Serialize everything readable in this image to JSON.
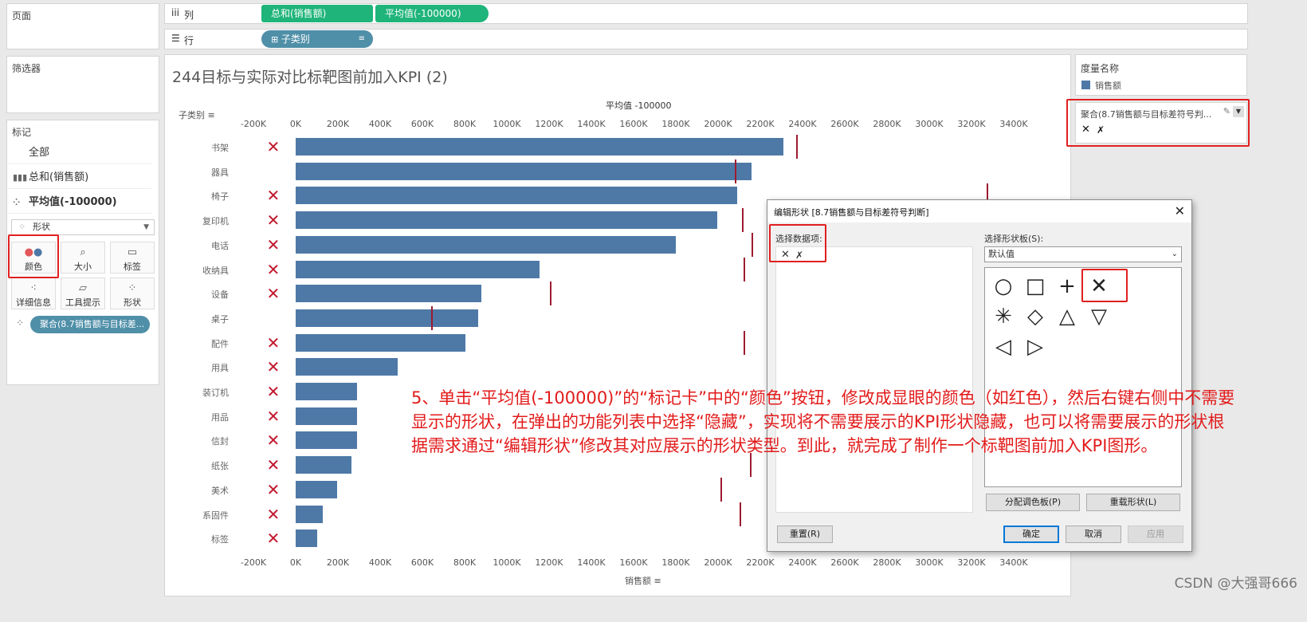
{
  "left_panel": {
    "pages_title": "页面",
    "filters_title": "筛选器",
    "marks_title": "标记",
    "marks_rows": [
      {
        "label": "全部",
        "icon": "none"
      },
      {
        "label": "总和(销售额)",
        "icon": "bar-chart-icon"
      },
      {
        "label": "平均值(-100000)",
        "icon": "shapes-icon"
      }
    ],
    "mark_type": "形状",
    "buttons": {
      "color": "颜色",
      "size": "大小",
      "label": "标签",
      "detail": "详细信息",
      "tooltip": "工具提示",
      "shape": "形状"
    },
    "shape_pill": "聚合(8.7销售额与目标差..."
  },
  "shelves": {
    "columns_icon": "iii",
    "columns_label": "列",
    "columns_pills": [
      "总和(销售额)",
      "平均值(-100000)"
    ],
    "rows_icon": "☰",
    "rows_label": "行",
    "rows_pill": "子类别"
  },
  "view": {
    "title": "244目标与实际对比标靶图前加入KPI (2)",
    "rows_header": "子类别",
    "top_axis_title": "平均值 -100000",
    "bottom_axis_title": "销售额"
  },
  "legend": {
    "title": "度量名称",
    "item": "销售额",
    "item_color": "#4e79a7",
    "shape_card_title": "聚合(8.7销售额与目标差符号判...",
    "shape_items": [
      "✕",
      "✗"
    ]
  },
  "chart_data": {
    "type": "bar",
    "xlim": [
      -200000,
      3500000
    ],
    "x_ticks": [
      "-200K",
      "0K",
      "200K",
      "400K",
      "600K",
      "800K",
      "1000K",
      "1200K",
      "1400K",
      "1600K",
      "1800K",
      "2000K",
      "2200K",
      "2400K",
      "2600K",
      "2800K",
      "3000K",
      "3200K",
      "3400K"
    ],
    "categories": [
      "书架",
      "器具",
      "椅子",
      "复印机",
      "电话",
      "收纳具",
      "设备",
      "桌子",
      "配件",
      "用具",
      "装订机",
      "用品",
      "信封",
      "纸张",
      "美术",
      "系固件",
      "标签"
    ],
    "series": [
      {
        "name": "销售额",
        "values": [
          2310000,
          2160000,
          2090000,
          1995000,
          1800000,
          1155000,
          878000,
          865000,
          805000,
          482000,
          292000,
          290000,
          290000,
          265000,
          198000,
          130000,
          100000
        ]
      }
    ],
    "targets": [
      2370000,
      2080000,
      3270000,
      2115000,
      2160000,
      2120000,
      1205000,
      640000,
      2120000,
      null,
      null,
      null,
      null,
      2150000,
      2010000,
      2100000,
      null
    ],
    "kpi_shown": [
      true,
      false,
      true,
      true,
      true,
      true,
      true,
      false,
      true,
      true,
      true,
      true,
      true,
      true,
      true,
      true,
      true
    ],
    "kpi_shape": "✕",
    "kpi_x": -100000,
    "bar_color": "#4e79a7",
    "target_color": "#9c1b30",
    "kpi_color": "#c0182d"
  },
  "dialog": {
    "title": "编辑形状 [8.7销售额与目标差符号判断]",
    "select_data_label": "选择数据项:",
    "data_items": [
      "✕",
      "✗"
    ],
    "select_palette_label": "选择形状板(S):",
    "palette_value": "默认值",
    "shapes": [
      "○",
      "□",
      "+",
      "✕",
      "✳",
      "◇",
      "△",
      "▽",
      "◁",
      "▷"
    ],
    "assign_palette": "分配调色板(P)",
    "reload_shapes": "重载形状(L)",
    "reset": "重置(R)",
    "ok": "确定",
    "cancel": "取消",
    "apply": "应用"
  },
  "annotation": "5、单击“平均值(-100000)”的“标记卡”中的“颜色”按钮，修改成显眼的颜色（如红色），然后右键右侧中不需要显示的形状，在弹出的功能列表中选择“隐藏”，实现将不需要展示的KPI形状隐藏，也可以将需要展示的形状根据需求通过“编辑形状”修改其对应展示的形状类型。到此，就完成了制作一个标靶图前加入KPI图形。",
  "watermark": "CSDN @大强哥666"
}
